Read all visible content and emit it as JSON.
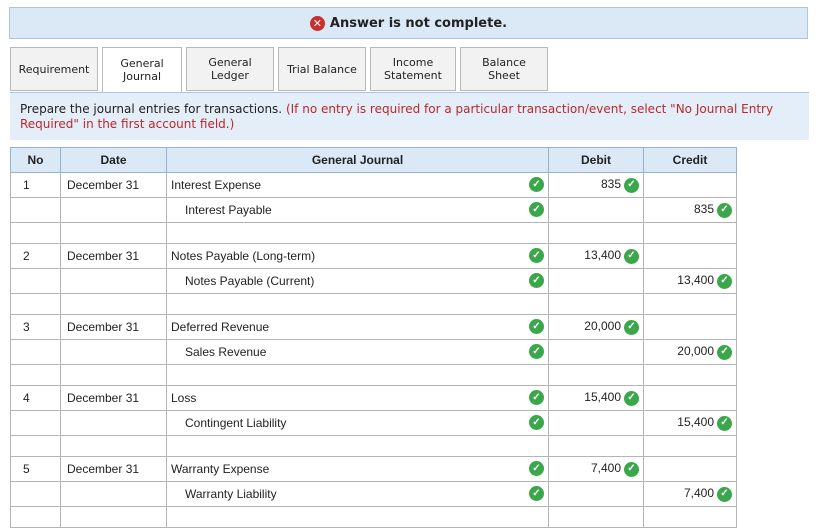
{
  "banner": {
    "text": "Answer is not complete."
  },
  "tabs": [
    {
      "label_lines": [
        "Requirement"
      ]
    },
    {
      "label_lines": [
        "General",
        "Journal"
      ]
    },
    {
      "label_lines": [
        "General",
        "Ledger"
      ]
    },
    {
      "label_lines": [
        "Trial Balance"
      ]
    },
    {
      "label_lines": [
        "Income",
        "Statement"
      ]
    },
    {
      "label_lines": [
        "Balance Sheet"
      ]
    }
  ],
  "instruction": {
    "main": "Prepare the journal entries for transactions.",
    "note": "(If no entry is required for a particular transaction/event, select \"No Journal Entry Required\" in the first account field.)"
  },
  "table": {
    "headers": {
      "no": "No",
      "date": "Date",
      "journal": "General Journal",
      "debit": "Debit",
      "credit": "Credit"
    },
    "entries": [
      {
        "no": "1",
        "date": "December 31",
        "debit_account": "Interest Expense",
        "debit": "835",
        "credit_account": "Interest Payable",
        "credit": "835"
      },
      {
        "no": "2",
        "date": "December 31",
        "debit_account": "Notes Payable (Long-term)",
        "debit": "13,400",
        "credit_account": "Notes Payable (Current)",
        "credit": "13,400"
      },
      {
        "no": "3",
        "date": "December 31",
        "debit_account": "Deferred Revenue",
        "debit": "20,000",
        "credit_account": "Sales Revenue",
        "credit": "20,000"
      },
      {
        "no": "4",
        "date": "December 31",
        "debit_account": "Loss",
        "debit": "15,400",
        "credit_account": "Contingent Liability",
        "credit": "15,400"
      },
      {
        "no": "5",
        "date": "December 31",
        "debit_account": "Warranty Expense",
        "debit": "7,400",
        "credit_account": "Warranty Liability",
        "credit": "7,400"
      }
    ]
  },
  "colors": {
    "correct": "#3aa84a",
    "error": "#c9302c",
    "note": "#b8282c",
    "header_bg": "#dbe8f5"
  }
}
